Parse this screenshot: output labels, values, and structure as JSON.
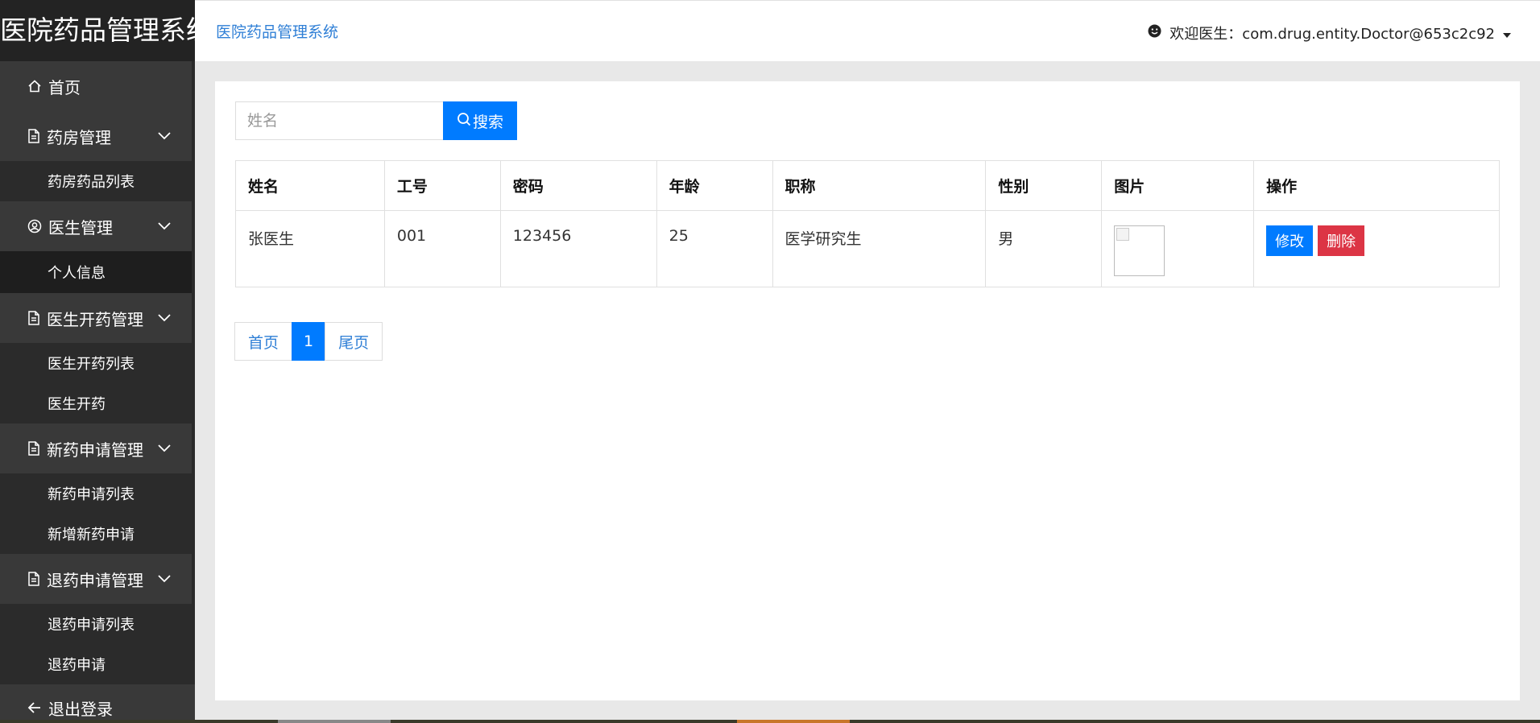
{
  "app": {
    "logo_text": "医院药品管理系统",
    "header_title": "医院药品管理系统",
    "welcome_text": "欢迎医生：com.drug.entity.Doctor@653c2c92"
  },
  "sidebar": {
    "home": "首页",
    "groups": [
      {
        "label": "药房管理",
        "items": [
          "药房药品列表"
        ]
      },
      {
        "label": "医生管理",
        "items": [
          "个人信息"
        ]
      },
      {
        "label": "医生开药管理",
        "items": [
          "医生开药列表",
          "医生开药"
        ]
      },
      {
        "label": "新药申请管理",
        "items": [
          "新药申请列表",
          "新增新药申请"
        ]
      },
      {
        "label": "退药申请管理",
        "items": [
          "退药申请列表",
          "退药申请"
        ]
      }
    ],
    "logout": "退出登录"
  },
  "search": {
    "placeholder": "姓名",
    "value": "",
    "button_label": "搜索"
  },
  "table": {
    "headers": [
      "姓名",
      "工号",
      "密码",
      "年龄",
      "职称",
      "性别",
      "图片",
      "操作"
    ],
    "rows": [
      [
        "张医生",
        "001",
        "123456",
        "25",
        "医学研究生",
        "男"
      ]
    ],
    "edit_label": "修改",
    "delete_label": "删除"
  },
  "pager": {
    "first": "首页",
    "current": "1",
    "last": "尾页"
  },
  "colors": {
    "primary": "#007bff",
    "danger": "#dc3545",
    "sidebar_bg": "#393939",
    "link": "#2f7fd6"
  }
}
